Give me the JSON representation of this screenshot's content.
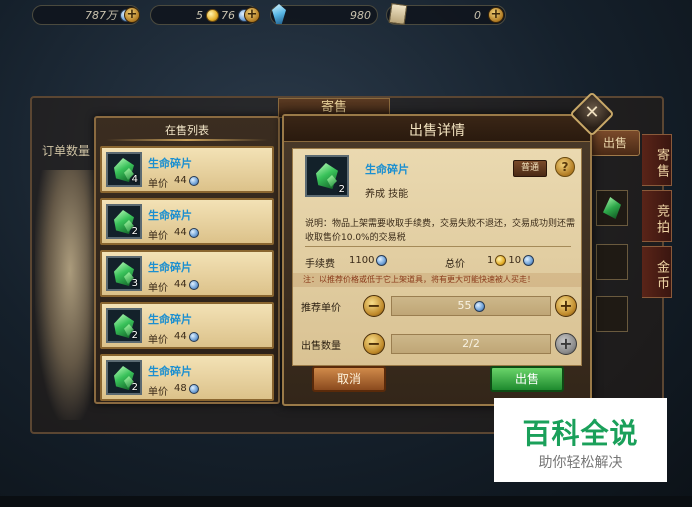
{
  "topbar": {
    "silver": "787万",
    "gold": "5",
    "gold_extra": "76",
    "gems": "980",
    "scrolls": "0"
  },
  "bg_window": {
    "title": "寄售",
    "column_label": "订单数量",
    "sell_button": "出售",
    "side_tabs": [
      "寄售",
      "竞拍",
      "金币"
    ]
  },
  "list": {
    "title": "在售列表",
    "price_label": "单价",
    "items": [
      {
        "name": "生命碎片",
        "qty": "4",
        "price": "44"
      },
      {
        "name": "生命碎片",
        "qty": "2",
        "price": "44"
      },
      {
        "name": "生命碎片",
        "qty": "3",
        "price": "44"
      },
      {
        "name": "生命碎片",
        "qty": "2",
        "price": "44"
      },
      {
        "name": "生命碎片",
        "qty": "2",
        "price": "48"
      }
    ]
  },
  "detail": {
    "title": "出售详情",
    "item_name": "生命碎片",
    "item_qty": "2",
    "tags": "养成    技能",
    "badge": "普通",
    "description": "说明：物品上架需要收取手续费，交易失败不退还，交易成功则还需收取售价10.0%的交易税",
    "fee_label": "手续费",
    "fee_value": "1100",
    "total_label": "总价",
    "total_gold": "1",
    "total_silver": "10",
    "note": "注：以推荐价格或低于它上架道具，将有更大可能快速被人买走！",
    "unit_price_label": "推荐单价",
    "unit_price_value": "55",
    "quantity_label": "出售数量",
    "quantity_value": "2/2",
    "cancel": "取消",
    "sell": "出售"
  },
  "watermark": {
    "main": "百科全说",
    "sub": "助你轻松解决"
  },
  "colors": {
    "item_name": "#1b8fd0",
    "confirm": "#1e8a2e",
    "cancel": "#8a4a1e",
    "note": "#8a3a1a"
  }
}
